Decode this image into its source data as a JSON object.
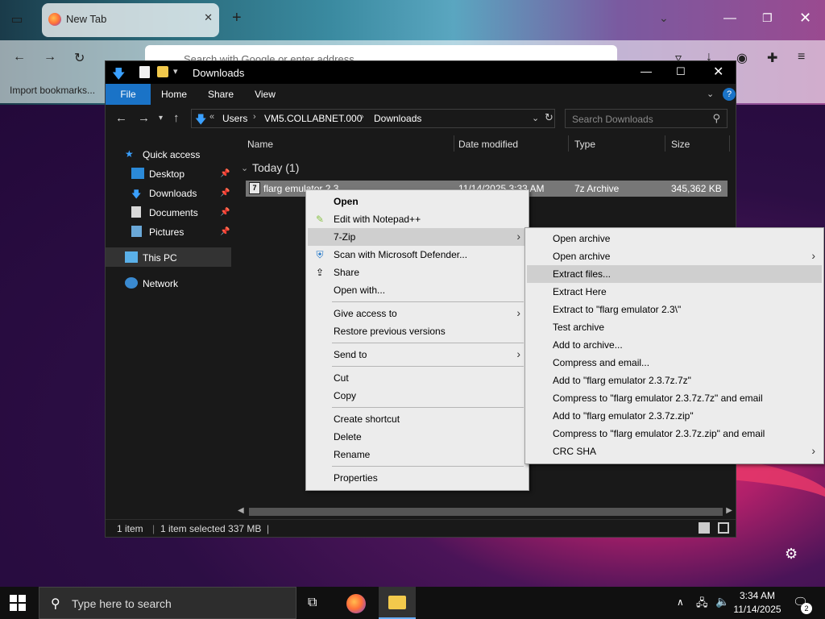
{
  "browser": {
    "tab_title": "New Tab",
    "url_placeholder": "Search with Google or enter address",
    "bookmark_import": "Import bookmarks..."
  },
  "explorer": {
    "title": "Downloads",
    "ribbon_tabs": [
      "File",
      "Home",
      "Share",
      "View"
    ],
    "breadcrumb": [
      "Users",
      "VM5.COLLABNET.000",
      "Downloads"
    ],
    "search_placeholder": "Search Downloads",
    "nav": {
      "quick_access": "Quick access",
      "desktop": "Desktop",
      "downloads": "Downloads",
      "documents": "Documents",
      "pictures": "Pictures",
      "this_pc": "This PC",
      "network": "Network"
    },
    "columns": {
      "name": "Name",
      "date": "Date modified",
      "type": "Type",
      "size": "Size"
    },
    "group": "Today (1)",
    "file": {
      "name": "flarg emulator 2.3",
      "date": "11/14/2025 3:33 AM",
      "type": "7z Archive",
      "size": "345,362 KB"
    },
    "status": {
      "count": "1 item",
      "selected": "1 item selected  337 MB"
    }
  },
  "context_menu": {
    "items": [
      "Open",
      "Edit with Notepad++",
      "7-Zip",
      "Scan with Microsoft Defender...",
      "Share",
      "Open with...",
      "Give access to",
      "Restore previous versions",
      "Send to",
      "Cut",
      "Copy",
      "Create shortcut",
      "Delete",
      "Rename",
      "Properties"
    ]
  },
  "submenu_7zip": {
    "items": [
      "Open archive",
      "Open archive",
      "Extract files...",
      "Extract Here",
      "Extract to \"flarg emulator 2.3\\\"",
      "Test archive",
      "Add to archive...",
      "Compress and email...",
      "Add to \"flarg emulator 2.3.7z.7z\"",
      "Compress to \"flarg emulator 2.3.7z.7z\" and email",
      "Add to \"flarg emulator 2.3.7z.zip\"",
      "Compress to \"flarg emulator 2.3.7z.zip\" and email",
      "CRC SHA"
    ]
  },
  "taskbar": {
    "search_placeholder": "Type here to search",
    "time": "3:34 AM",
    "date": "11/14/2025",
    "notification_count": "2"
  },
  "colors": {
    "accent": "#1a73c7",
    "explorer_bg": "#191919",
    "menu_bg": "#ececec"
  }
}
